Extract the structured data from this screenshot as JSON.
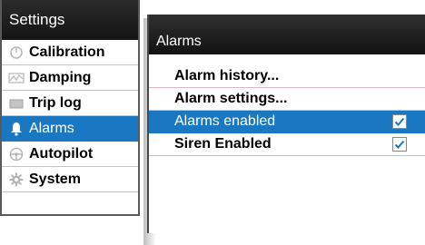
{
  "settings": {
    "title": "Settings",
    "items": [
      {
        "label": "Calibration",
        "icon": "calibration-icon",
        "selected": false
      },
      {
        "label": "Damping",
        "icon": "damping-icon",
        "selected": false
      },
      {
        "label": "Trip log",
        "icon": "trip-log-icon",
        "selected": false
      },
      {
        "label": "Alarms",
        "icon": "bell-icon",
        "selected": true
      },
      {
        "label": "Autopilot",
        "icon": "steering-wheel-icon",
        "selected": false
      },
      {
        "label": "System",
        "icon": "gear-icon",
        "selected": false
      }
    ]
  },
  "alarms": {
    "title": "Alarms",
    "items": [
      {
        "label": "Alarm history...",
        "checked": null,
        "selected": false
      },
      {
        "label": "Alarm settings...",
        "checked": null,
        "selected": false
      },
      {
        "label": "Alarms enabled",
        "checked": true,
        "selected": true
      },
      {
        "label": "Siren Enabled",
        "checked": true,
        "selected": false
      }
    ]
  },
  "colors": {
    "selection": "#1a78c2",
    "header": "#1a1a1a",
    "divider": "#d8b7be"
  }
}
